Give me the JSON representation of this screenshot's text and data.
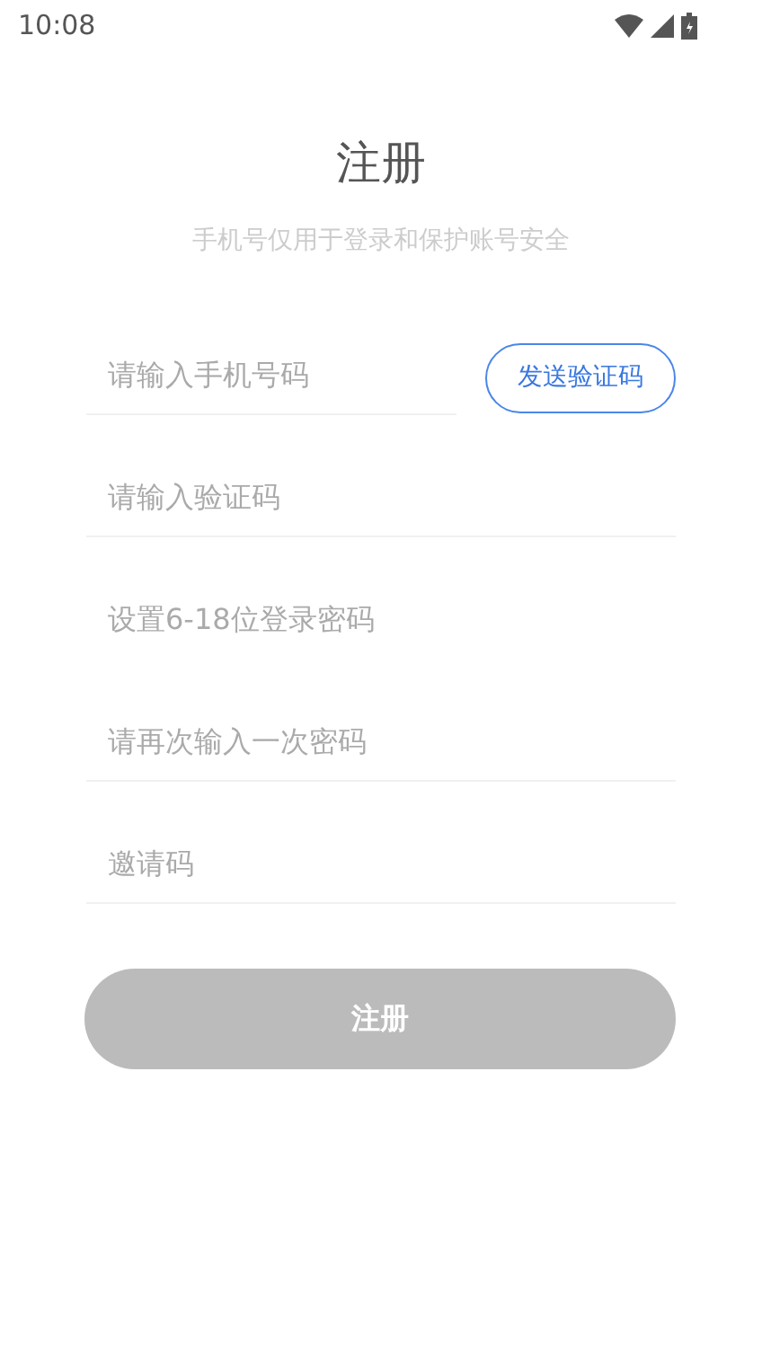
{
  "status_bar": {
    "time": "10:08"
  },
  "title": "注册",
  "subtitle": "手机号仅用于登录和保护账号安全",
  "fields": [
    {
      "placeholder": "请输入手机号码",
      "underlined": true,
      "action": "发送验证码"
    },
    {
      "placeholder": "请输入验证码",
      "underlined": true
    },
    {
      "placeholder": "设置6-18位登录密码",
      "underlined": false
    },
    {
      "placeholder": "请再次输入一次密码",
      "underlined": true
    },
    {
      "placeholder": "邀请码",
      "underlined": true
    }
  ],
  "submit": {
    "label": "注册",
    "disabled": true
  }
}
